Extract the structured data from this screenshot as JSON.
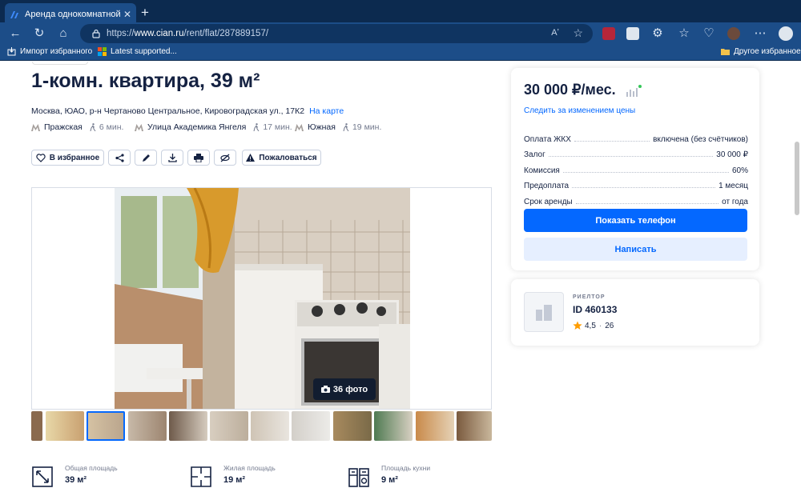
{
  "browser": {
    "tab_title": "Аренда однокомнатной квар",
    "url_prefix": "https://",
    "url_host": "www.cian.ru",
    "url_path": "/rent/flat/287889157/",
    "reader_label": "Aʼ",
    "bookmarks": [
      {
        "label": "Импорт избранного"
      },
      {
        "label": "Latest supported..."
      }
    ],
    "other_bookmarks": "Другое избранное"
  },
  "listing": {
    "title": "1-комн. квартира, 39 м²",
    "address": "Москва, ЮАО, р-н Чертаново Центральное, Кировоградская ул., 17К2",
    "map_link": "На карте",
    "metro": [
      {
        "station": "Пражская",
        "walk": "6 мин."
      },
      {
        "station": "Улица Академика Янгеля",
        "walk": "17 мин."
      },
      {
        "station": "Южная",
        "walk": "19 мин."
      }
    ],
    "metro_color": "#a59f9c",
    "actions": {
      "favorite": "В избранное",
      "complain": "Пожаловаться"
    },
    "photo_count": "36 фото",
    "facts": [
      {
        "label": "Общая площадь",
        "value": "39 м²",
        "icon": "total-area-icon"
      },
      {
        "label": "Жилая площадь",
        "value": "19 м²",
        "icon": "living-area-icon"
      },
      {
        "label": "Площадь кухни",
        "value": "9 м²",
        "icon": "kitchen-area-icon"
      }
    ]
  },
  "offer": {
    "price": "30 000 ₽/мес.",
    "follow_price": "Следить за изменением цены",
    "terms": [
      {
        "label": "Оплата ЖКХ",
        "value": "включена (без счётчиков)"
      },
      {
        "label": "Залог",
        "value": "30 000 ₽"
      },
      {
        "label": "Комиссия",
        "value": "60%"
      },
      {
        "label": "Предоплата",
        "value": "1 месяц"
      },
      {
        "label": "Срок аренды",
        "value": "от года"
      }
    ],
    "show_phone": "Показать телефон",
    "write": "Написать",
    "accent_color": "#0468ff"
  },
  "agent": {
    "role": "РИЕЛТОР",
    "id": "ID 460133",
    "rating": "4,5",
    "reviews": "26"
  }
}
